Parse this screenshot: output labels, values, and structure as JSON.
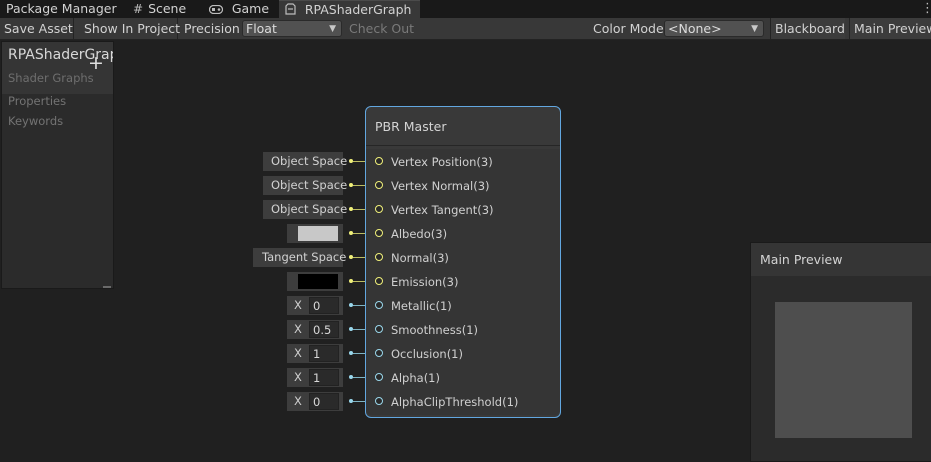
{
  "tabs": [
    {
      "label": "Package Manager",
      "icon": ""
    },
    {
      "label": "Scene",
      "icon": "hash-icon"
    },
    {
      "label": "Game",
      "icon": "gamepad-icon"
    },
    {
      "label": "RPAShaderGraph",
      "icon": "shader-graph-icon",
      "active": true
    }
  ],
  "toolbar": {
    "save_asset": "Save Asset",
    "show_in_project": "Show In Project",
    "precision_label": "Precision",
    "precision_value": "Float",
    "check_out": "Check Out",
    "color_mode_label": "Color Mode",
    "color_mode_value": "<None>",
    "blackboard": "Blackboard",
    "main_preview": "Main Preview"
  },
  "blackboard": {
    "title": "RPAShaderGraph",
    "subtitle": "Shader Graphs",
    "add": "+",
    "sections": [
      "Properties",
      "Keywords"
    ]
  },
  "master_node": {
    "title": "PBR Master",
    "ports": [
      {
        "label": "Vertex Position(3)",
        "type": "vector3"
      },
      {
        "label": "Vertex Normal(3)",
        "type": "vector3"
      },
      {
        "label": "Vertex Tangent(3)",
        "type": "vector3"
      },
      {
        "label": "Albedo(3)",
        "type": "vector3"
      },
      {
        "label": "Normal(3)",
        "type": "vector3"
      },
      {
        "label": "Emission(3)",
        "type": "vector3"
      },
      {
        "label": "Metallic(1)",
        "type": "float"
      },
      {
        "label": "Smoothness(1)",
        "type": "float"
      },
      {
        "label": "Occlusion(1)",
        "type": "float"
      },
      {
        "label": "Alpha(1)",
        "type": "float"
      },
      {
        "label": "AlphaClipThreshold(1)",
        "type": "float"
      }
    ]
  },
  "inputs": [
    {
      "kind": "space",
      "text": "Object Space"
    },
    {
      "kind": "space",
      "text": "Object Space"
    },
    {
      "kind": "space",
      "text": "Object Space"
    },
    {
      "kind": "color",
      "color": "#c8c8c8"
    },
    {
      "kind": "space",
      "text": "Tangent Space"
    },
    {
      "kind": "color",
      "color": "#000000"
    },
    {
      "kind": "float",
      "axis": "X",
      "value": "0"
    },
    {
      "kind": "float",
      "axis": "X",
      "value": "0.5"
    },
    {
      "kind": "float",
      "axis": "X",
      "value": "1"
    },
    {
      "kind": "float",
      "axis": "X",
      "value": "1"
    },
    {
      "kind": "float",
      "axis": "X",
      "value": "0"
    }
  ],
  "main_preview": {
    "title": "Main Preview"
  },
  "colors": {
    "accent": "#62a7e0",
    "vector3_port": "#f0f07a",
    "float_port": "#9ad8ec"
  }
}
